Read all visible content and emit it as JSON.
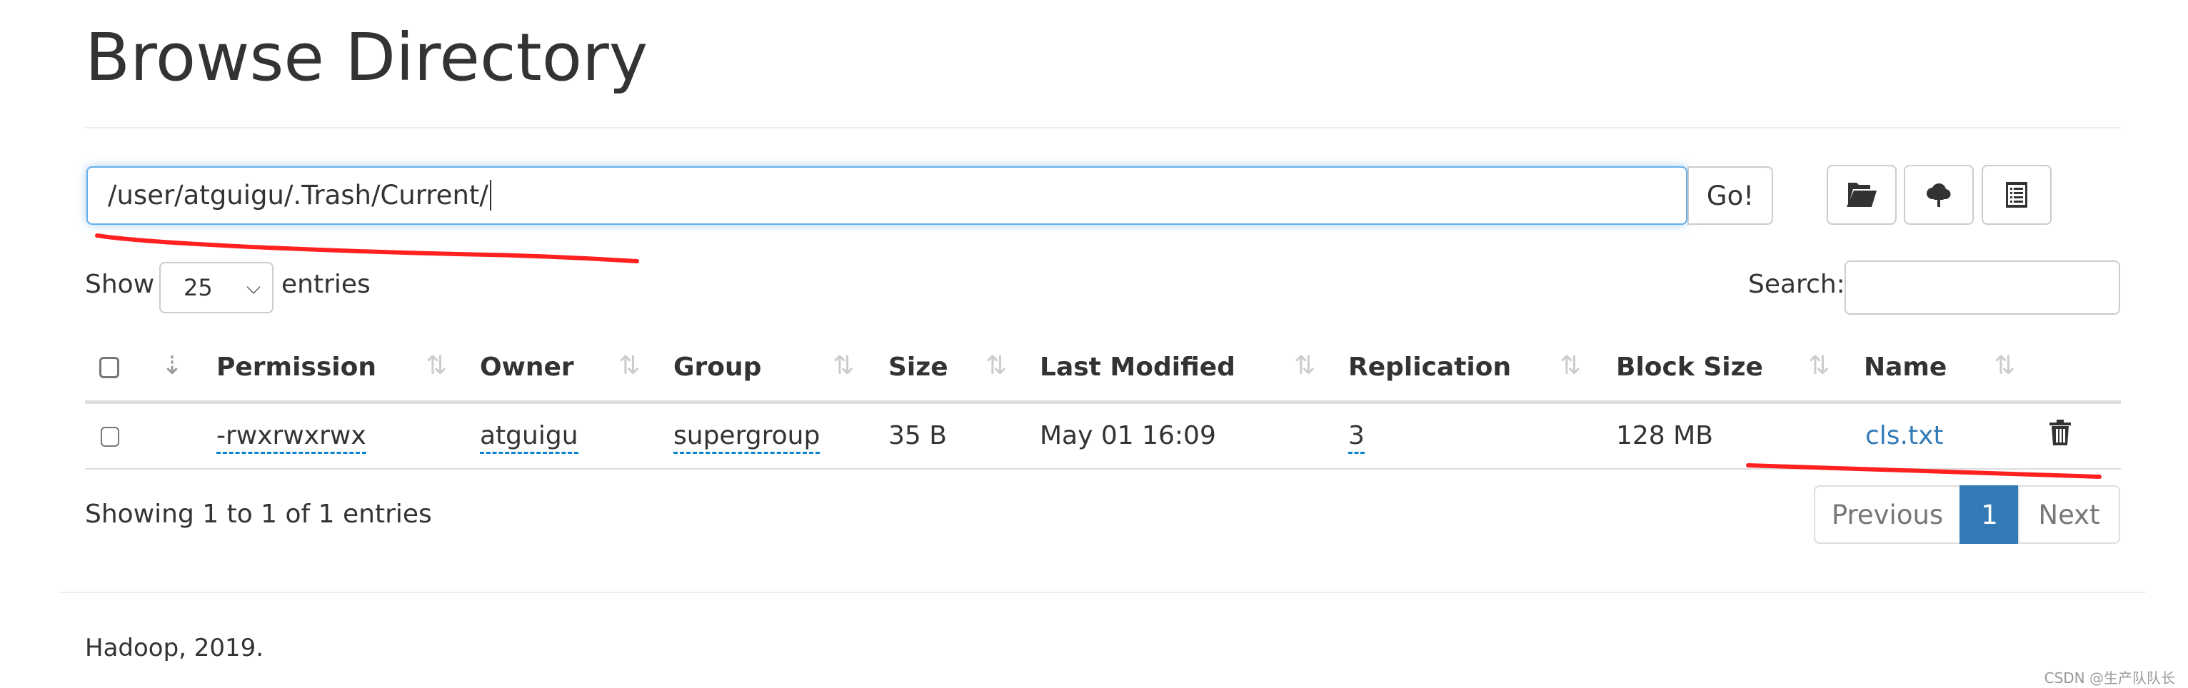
{
  "title": "Browse Directory",
  "path_input": {
    "value": "/user/atguigu/.Trash/Current/",
    "go_label": "Go!"
  },
  "toolbar": {
    "icons": [
      "folder-open-icon",
      "cloud-upload-icon",
      "list-alt-icon"
    ]
  },
  "length": {
    "show_label": "Show",
    "value": "25",
    "entries_label": "entries"
  },
  "search": {
    "label": "Search:",
    "value": ""
  },
  "table": {
    "columns": [
      "Permission",
      "Owner",
      "Group",
      "Size",
      "Last Modified",
      "Replication",
      "Block Size",
      "Name"
    ],
    "rows": [
      {
        "permission": "-rwxrwxrwx",
        "owner": "atguigu",
        "group": "supergroup",
        "size": "35 B",
        "modified": "May 01 16:09",
        "replication": "3",
        "block_size": "128 MB",
        "name": "cls.txt"
      }
    ]
  },
  "info": "Showing 1 to 1 of 1 entries",
  "pagination": {
    "previous": "Previous",
    "current": "1",
    "next": "Next"
  },
  "footer": "Hadoop, 2019.",
  "watermark": "CSDN @生产队队长",
  "colors": {
    "accent": "#337ab7",
    "annotation": "#ff2020",
    "link": "#337ab7"
  }
}
